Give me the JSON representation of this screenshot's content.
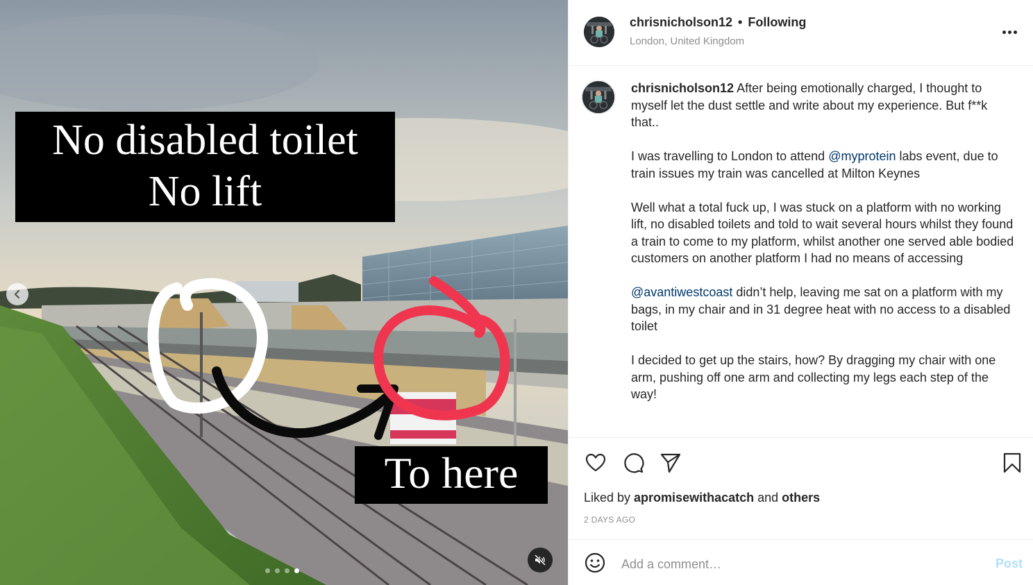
{
  "post": {
    "author": "chrisnicholson12",
    "separator": "•",
    "follow_status": "Following",
    "location": "London, United Kingdom",
    "more_icon": "more-horizontal-icon"
  },
  "media": {
    "overlay_top_line1": "No disabled toilet",
    "overlay_top_line2": "No lift",
    "overlay_bottom": "To here",
    "carousel": {
      "total_slides": 4,
      "current_slide": 4
    },
    "prev_icon": "chevron-left-icon",
    "mute_icon": "muted-speaker-icon"
  },
  "caption": {
    "username": "chrisnicholson12",
    "p1": "After being emotionally charged, I thought to myself let the dust settle and write about my experience. But f**k that..",
    "p2_before": "I was travelling to London to attend ",
    "p2_mention": "@myprotein",
    "p2_after": " labs event, due to train issues my train was cancelled at Milton Keynes",
    "p3": "Well what a total fuck up, I was stuck on a platform with no working lift, no disabled toilets and told to wait several hours whilst they found a train to come to my platform, whilst another one served able bodied customers on another platform I had no means of accessing",
    "p4_mention": "@avantiwestcoast",
    "p4_after": " didn’t help, leaving me sat on a platform with my bags, in my chair and in 31 degree heat with no access to a disabled toilet",
    "p5": "I decided to get up the stairs, how? By dragging my chair with one arm, pushing off one arm and collecting my legs each step of the way!"
  },
  "actions": {
    "like_icon": "heart-icon",
    "comment_icon": "comment-bubble-icon",
    "share_icon": "paper-plane-icon",
    "save_icon": "bookmark-icon",
    "liked_by_prefix": "Liked by ",
    "liked_by_user": "apromisewithacatch",
    "liked_by_mid": " and ",
    "liked_by_others": "others",
    "timestamp": "2 DAYS AGO"
  },
  "comment_box": {
    "emoji_icon": "emoji-smiley-icon",
    "placeholder": "Add a comment…",
    "value": "",
    "post_label": "Post"
  },
  "colors": {
    "link": "#00376b",
    "post_disabled": "#b2dffc",
    "secondary_text": "#8e8e8e",
    "annotation_red": "#f0364f"
  }
}
